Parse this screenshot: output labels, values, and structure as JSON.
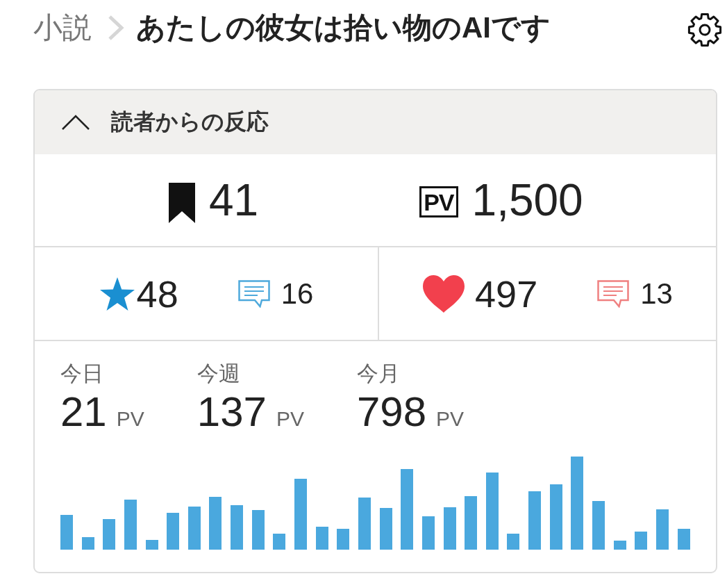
{
  "breadcrumb": {
    "parent": "小説",
    "title": "あたしの彼女は拾い物のAIです"
  },
  "panel": {
    "title": "読者からの反応",
    "expanded": true,
    "totals": [
      {
        "kind": "bookmarks",
        "value": "41"
      },
      {
        "kind": "page_views",
        "badge": "PV",
        "value": "1,500"
      }
    ],
    "reactions": [
      {
        "kind": "stars",
        "value": "48",
        "comments": "16"
      },
      {
        "kind": "hearts",
        "value": "497",
        "comments": "13"
      }
    ],
    "periods": [
      {
        "label": "今日",
        "value": "21",
        "unit": "PV"
      },
      {
        "label": "今週",
        "value": "137",
        "unit": "PV"
      },
      {
        "label": "今月",
        "value": "798",
        "unit": "PV"
      }
    ]
  }
}
